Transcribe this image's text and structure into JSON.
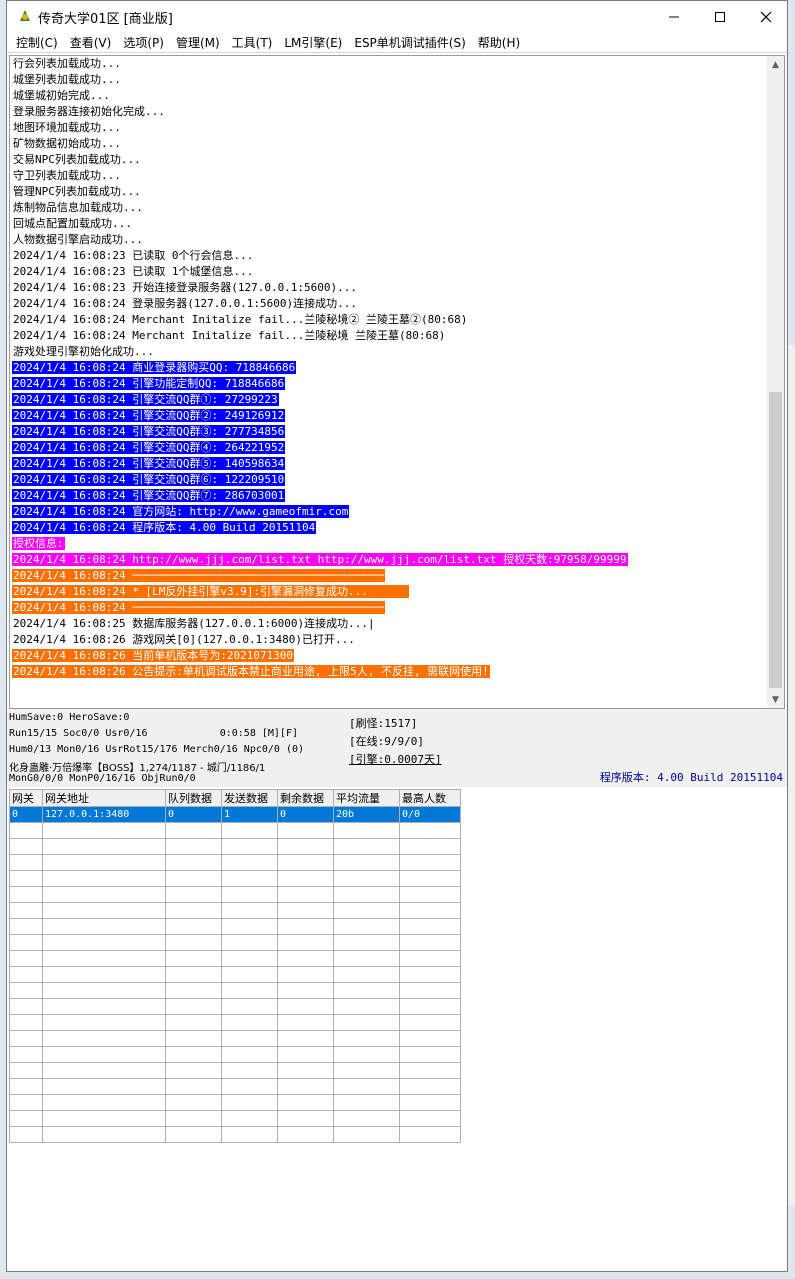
{
  "window": {
    "title": "传奇大学01区 [商业版]"
  },
  "menu": [
    "控制(C)",
    "查看(V)",
    "选项(P)",
    "管理(M)",
    "工具(T)",
    "LM引擎(E)",
    "ESP单机调试插件(S)",
    "帮助(H)"
  ],
  "log": [
    {
      "text": "行会列表加载成功...",
      "hl": ""
    },
    {
      "text": "城堡列表加载成功...",
      "hl": ""
    },
    {
      "text": "城堡城初始完成...",
      "hl": ""
    },
    {
      "text": "登录服务器连接初始化完成...",
      "hl": ""
    },
    {
      "text": "地图环境加载成功...",
      "hl": ""
    },
    {
      "text": "矿物数据初始成功...",
      "hl": ""
    },
    {
      "text": "交易NPC列表加载成功...",
      "hl": ""
    },
    {
      "text": "守卫列表加载成功...",
      "hl": ""
    },
    {
      "text": "管理NPC列表加载成功...",
      "hl": ""
    },
    {
      "text": "炼制物品信息加载成功...",
      "hl": ""
    },
    {
      "text": "回城点配置加载成功...",
      "hl": ""
    },
    {
      "text": "人物数据引擎启动成功...",
      "hl": ""
    },
    {
      "text": "2024/1/4 16:08:23 已读取 0个行会信息...",
      "hl": ""
    },
    {
      "text": "2024/1/4 16:08:23 已读取 1个城堡信息...",
      "hl": ""
    },
    {
      "text": "2024/1/4 16:08:23 开始连接登录服务器(127.0.0.1:5600)...",
      "hl": ""
    },
    {
      "text": "2024/1/4 16:08:24 登录服务器(127.0.0.1:5600)连接成功...",
      "hl": ""
    },
    {
      "text": "2024/1/4 16:08:24 Merchant Initalize fail...兰陵秘境② 兰陵王墓②(80:68)",
      "hl": ""
    },
    {
      "text": "2024/1/4 16:08:24 Merchant Initalize fail...兰陵秘境 兰陵王墓(80:68)",
      "hl": ""
    },
    {
      "text": "游戏处理引擎初始化成功...",
      "hl": ""
    },
    {
      "text": "2024/1/4 16:08:24 商业登录器购买QQ: 718846686",
      "hl": "blue"
    },
    {
      "text": "2024/1/4 16:08:24 引擎功能定制QQ: 718846686",
      "hl": "blue"
    },
    {
      "text": "2024/1/4 16:08:24 引擎交流QQ群①: 27299223",
      "hl": "blue"
    },
    {
      "text": "2024/1/4 16:08:24 引擎交流QQ群②: 249126912",
      "hl": "blue"
    },
    {
      "text": "2024/1/4 16:08:24 引擎交流QQ群③: 277734856",
      "hl": "blue"
    },
    {
      "text": "2024/1/4 16:08:24 引擎交流QQ群④: 264221952",
      "hl": "blue"
    },
    {
      "text": "2024/1/4 16:08:24 引擎交流QQ群⑤: 140598634",
      "hl": "blue"
    },
    {
      "text": "2024/1/4 16:08:24 引擎交流QQ群⑥: 122209510",
      "hl": "blue"
    },
    {
      "text": "2024/1/4 16:08:24 引擎交流QQ群⑦: 286703001",
      "hl": "blue"
    },
    {
      "text": "2024/1/4 16:08:24 官方网站: http://www.gameofmir.com",
      "hl": "blue"
    },
    {
      "text": "2024/1/4 16:08:24 程序版本: 4.00 Build 20151104",
      "hl": "blue"
    },
    {
      "text": "授权信息:",
      "hl": "magenta"
    },
    {
      "text": "2024/1/4 16:08:24 http://www.jjj.com/list.txt http://www.jjj.com/list.txt 授权天数:97958/99999",
      "hl": "magenta"
    },
    {
      "text": "2024/1/4 16:08:24 ──────────────────────────────────────",
      "hl": "orange"
    },
    {
      "text": "2024/1/4 16:08:24 * [LM反外挂引擎v3.9]:引擎漏洞修复成功...      ",
      "hl": "orange"
    },
    {
      "text": "2024/1/4 16:08:24 ──────────────────────────────────────",
      "hl": "orange"
    },
    {
      "text": "2024/1/4 16:08:25 数据库服务器(127.0.0.1:6000)连接成功...|",
      "hl": ""
    },
    {
      "text": "2024/1/4 16:08:26 游戏网关[0](127.0.0.1:3480)已打开...",
      "hl": ""
    },
    {
      "text": "2024/1/4 16:08:26 当前单机版本号为:2021071300",
      "hl": "orange"
    },
    {
      "text": "2024/1/4 16:08:26 公告提示:单机调试版本禁止商业用途, 上限5人, 不反挂, 需联网使用!",
      "hl": "orange"
    }
  ],
  "status": {
    "line1": "HumSave:0 HeroSave:0",
    "line2": "Run15/15 Soc0/0 Usr0/16            0:0:58 [M][F]",
    "line3": "Hum0/13 Mon0/16 UsrRot15/176 Merch0/16 Npc0/0 (0)",
    "line4": "化身蛊雕·万倍爆率【BOSS】1,274/1187 - 城门/1186/1",
    "line5": "MonG0/0/0 MonP0/16/16 ObjRun0/0",
    "refresh": "[刷怪:1517]",
    "online": "[在线:9/9/0]",
    "engine": "[引擎:0.0007天]",
    "version": "程序版本: 4.00 Build 20151104"
  },
  "gate_table": {
    "headers": [
      "网关",
      "网关地址",
      "队列数据",
      "发送数据",
      "剩余数据",
      "平均流量",
      "最高人数"
    ],
    "row": [
      "0",
      "127.0.0.1:3480",
      "0",
      "1",
      "0",
      "20b",
      "0/0"
    ]
  }
}
